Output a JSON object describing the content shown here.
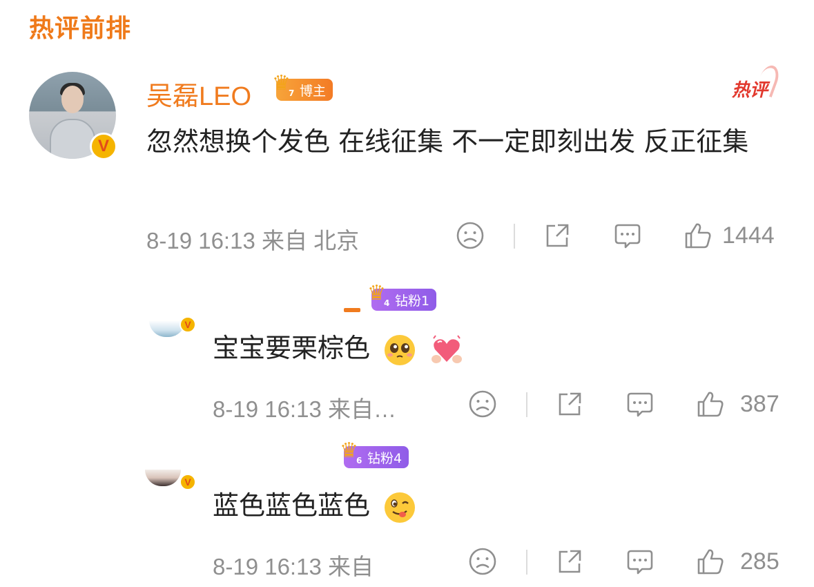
{
  "section_title": "热评前排",
  "main_comment": {
    "username": "吴磊LEO",
    "badge_label": "博主",
    "badge_level": "7",
    "hot_tag": "热评",
    "text": "忽然想换个发色 在线征集 不一定即刻出发 反正征集",
    "meta": "8-19 16:13 来自 北京",
    "like_count": "1444"
  },
  "replies": [
    {
      "badge_label": "钻粉1",
      "badge_level": "4",
      "text": "宝宝要栗棕色",
      "emojis": [
        "pleading-face-emoji",
        "heart-hands-emoji"
      ],
      "meta": "8-19 16:13 来自…",
      "like_count": "387"
    },
    {
      "badge_label": "钻粉4",
      "badge_level": "6",
      "text": "蓝色蓝色蓝色",
      "emojis": [
        "yummy-face-emoji"
      ],
      "meta": "8-19 16:13 来自",
      "like_count": "285"
    }
  ],
  "icons": {
    "dislike": "sad-face-icon",
    "share": "share-icon",
    "comment": "comment-icon",
    "like": "thumbs-up-icon",
    "verified": "verified-v-icon"
  },
  "colors": {
    "accent_orange": "#f07b1e",
    "hot_red": "#e2392e",
    "fan_purple": "#9a62ec",
    "meta_gray": "#8f8f8f",
    "verified_yellow": "#f5b400"
  }
}
